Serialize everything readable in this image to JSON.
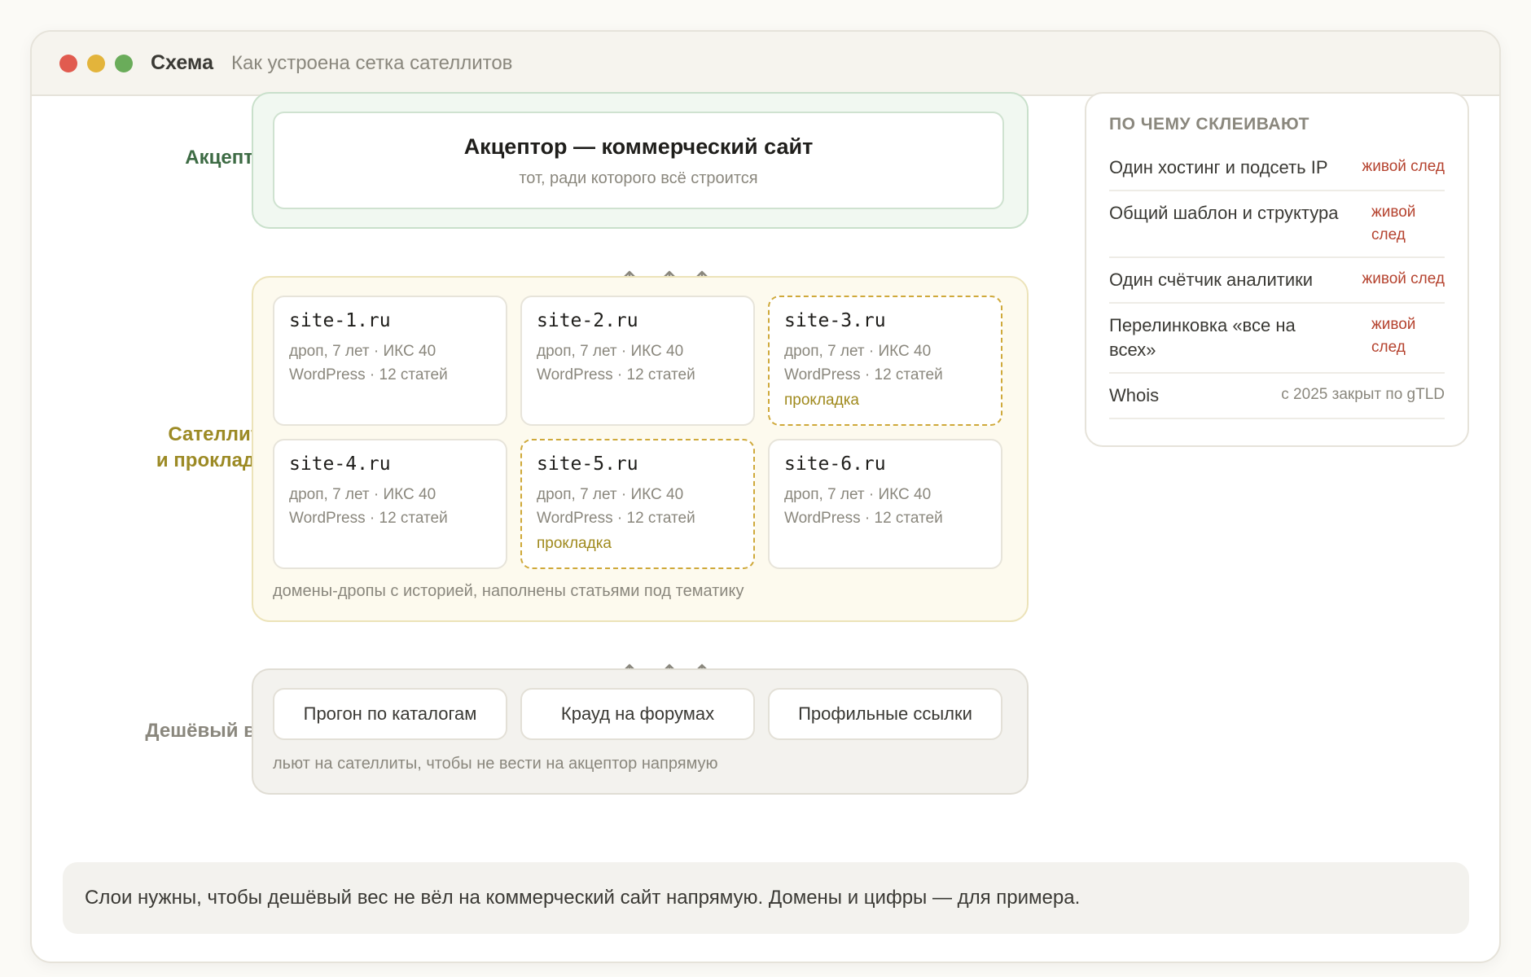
{
  "window": {
    "title": "Схема",
    "subtitle": "Как устроена сетка сателлитов"
  },
  "layers": {
    "acceptor_label": "Акцептор",
    "satellites_label_line1": "Сателлиты",
    "satellites_label_line2": "и прокладки",
    "cheap_label": "Дешёвый вес"
  },
  "acceptor": {
    "title": "Акцептор — коммерческий сайт",
    "subtitle": "тот, ради которого всё строится"
  },
  "sites": [
    {
      "name": "site-1.ru",
      "meta1": "дроп, 7 лет · ИКС 40",
      "meta2": "WordPress · 12 статей",
      "tag": ""
    },
    {
      "name": "site-2.ru",
      "meta1": "дроп, 7 лет · ИКС 40",
      "meta2": "WordPress · 12 статей",
      "tag": ""
    },
    {
      "name": "site-3.ru",
      "meta1": "дроп, 7 лет · ИКС 40",
      "meta2": "WordPress · 12 статей",
      "tag": "прокладка"
    },
    {
      "name": "site-4.ru",
      "meta1": "дроп, 7 лет · ИКС 40",
      "meta2": "WordPress · 12 статей",
      "tag": ""
    },
    {
      "name": "site-5.ru",
      "meta1": "дроп, 7 лет · ИКС 40",
      "meta2": "WordPress · 12 статей",
      "tag": "прокладка"
    },
    {
      "name": "site-6.ru",
      "meta1": "дроп, 7 лет · ИКС 40",
      "meta2": "WordPress · 12 статей",
      "tag": ""
    }
  ],
  "satellites_note": "домены-дропы с историей, наполнены статьями под тематику",
  "cheap": {
    "items": [
      "Прогон по каталогам",
      "Крауд на форумах",
      "Профильные ссылки"
    ],
    "note": "льют на сателлиты, чтобы не вести на акцептор напрямую"
  },
  "side": {
    "title": "ПО ЧЕМУ СКЛЕИВАЮТ",
    "rows": [
      {
        "k": "Один хостинг и подсеть IP",
        "v": "живой след"
      },
      {
        "k": "Общий шаблон и структура",
        "v": "живой след"
      },
      {
        "k": "Один счётчик аналитики",
        "v": "живой след"
      },
      {
        "k": "Перелинковка «все на всех»",
        "v": "живой след"
      },
      {
        "k": "Whois",
        "v": "с 2025 закрыт по gTLD"
      }
    ]
  },
  "footer": "Слои нужны, чтобы дешёвый вес не вёл на коммерческий сайт напрямую. Домены и цифры — для примера.",
  "colors": {
    "accent_green": "#3d6b44",
    "accent_olive": "#9c8a25",
    "trace_red": "#b5432f",
    "dot_red": "#e15b4f",
    "dot_yellow": "#e3b43b",
    "dot_green": "#6aac5a"
  },
  "icons": {
    "arrow": "arrow-up-icon"
  }
}
